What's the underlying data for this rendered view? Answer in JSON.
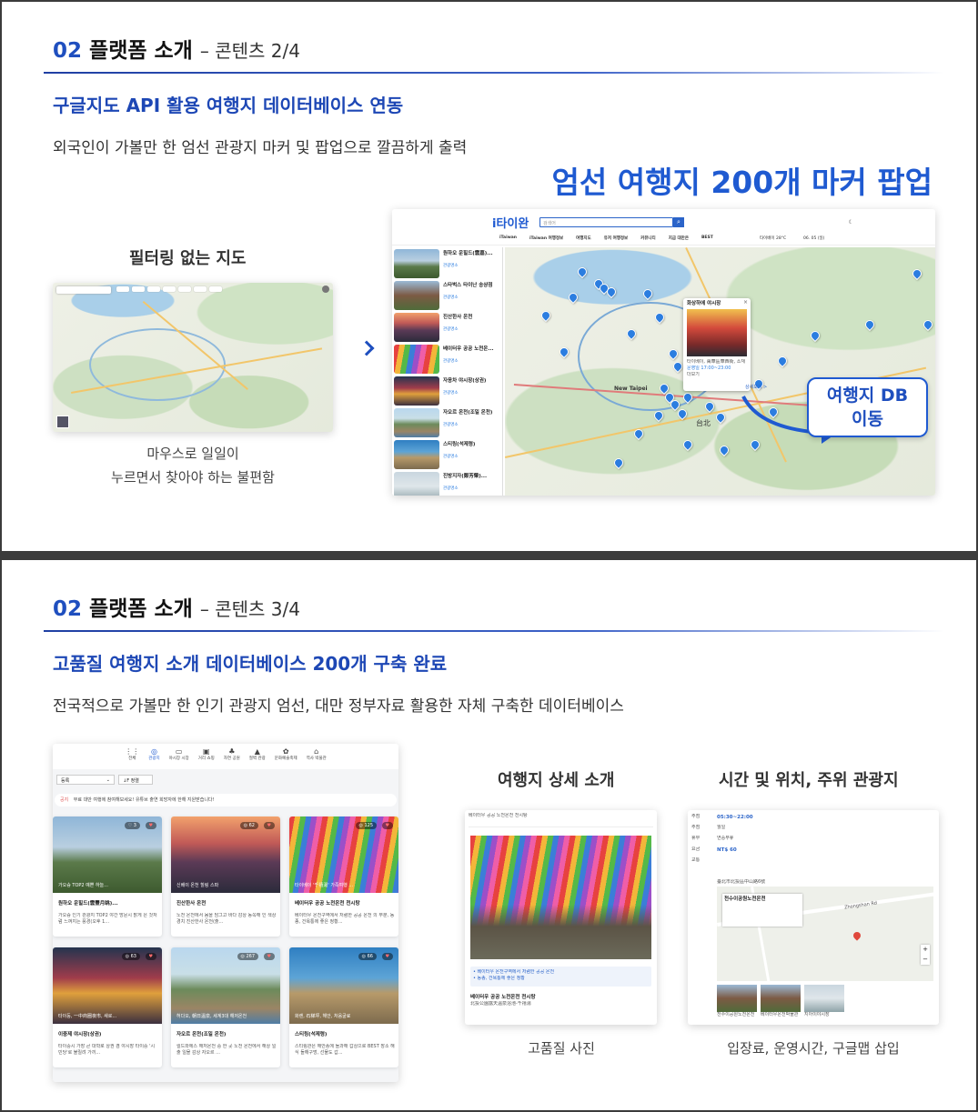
{
  "slide1": {
    "section_num": "02",
    "section_title": "플랫폼 소개",
    "section_sub": "– 콘텐츠 2/4",
    "heading": "구글지도 API 활용 여행지 데이터베이스 연동",
    "description": "외국인이 가볼만 한 엄선 관광지 마커 및 팝업으로 깔끔하게 출력",
    "highlight": "엄선 여행지 200개 마커 팝업",
    "left_caption": "필터링 없는 지도",
    "left_note_line1": "마우스로 일일이",
    "left_note_line2": "누르면서 찾아야 하는 불편함",
    "db_label_line1": "여행지 DB",
    "db_label_line2": "이동",
    "app": {
      "logo": "i타이완",
      "search_placeholder": "검색어",
      "nav": [
        "iTaiwan",
        "iTaiwan 여행정보",
        "여행지도",
        "유저 여행정보",
        "커뮤니티",
        "지금 대만은",
        "BEST"
      ],
      "weather": "타이베이 28°C",
      "date": "06. 05 (일)",
      "list": [
        {
          "title": "원하오 운힐드(雲嘉)...",
          "tag": "관광명소"
        },
        {
          "title": "스타벅스 타이난 송샹점",
          "tag": "관광명소"
        },
        {
          "title": "진산한사 온천",
          "tag": "관광명소"
        },
        {
          "title": "베이터우 공공 노천온...",
          "tag": "관광명소"
        },
        {
          "title": "자응차 야시장(상권)",
          "tag": "관광명소"
        },
        {
          "title": "자오르 온천(조일 온천)",
          "tag": "관광명소"
        },
        {
          "title": "스티링(석제령)",
          "tag": "관광명소"
        },
        {
          "title": "진방지자(鄭芳榮)...",
          "tag": "관광명소"
        }
      ],
      "popup_title": "화상하에 야시장",
      "popup_lines": [
        "타이베이, 萬華區華西街, 소재",
        "운영일 17:00~23:00",
        "더보기"
      ],
      "popup_more": "상세보기 >",
      "map_label_city": "New Taipei",
      "map_label_taipei": "台北"
    }
  },
  "slide2": {
    "section_num": "02",
    "section_title": "플랫폼 소개",
    "section_sub": "– 콘텐츠 3/4",
    "heading": "고품질 여행지 소개 데이터베이스 200개 구축 완료",
    "description": "전국적으로 가볼만 한 인기 관광지 엄선, 대만 정부자료 활용한 자체 구축한 데이터베이스",
    "categories": [
      "전체",
      "관광지",
      "야시장 시장",
      "거리 쇼핑",
      "자연 공원",
      "절벽 관광",
      "문화예술축제",
      "역사 박물관"
    ],
    "filter_sort": "등록",
    "filter_order": "↓F 정렬",
    "notice_tag": "공지",
    "notice_text": "무료 대만 여행에 참여해보세요! 유튜브 출연 희망자에 한해 지원받습니다!",
    "cards": [
      {
        "overlay": "가오슝 TOP2 예쁜 하늘...",
        "title": "원하오 운힐드(雲豐月眺)...",
        "desc": "가오슝 인기 관광지 TOP2 야간 방문시 밝게 은 것처럼 느껴지는 풍경(오후 1...",
        "views": "♡ 3",
        "grad": "g-sky"
      },
      {
        "overlay": "신베이 온천 힐링 스파",
        "title": "진산한사 온천",
        "desc": "노천 온천에서 몸을 담그고 바다 감상 동쪽해 인 색상 경치 진산한사 온천(출...",
        "views": "◎ 62",
        "grad": "g-sunset"
      },
      {
        "overlay": "타이베이 '千禧湯' 가족여행 ...",
        "title": "베이터우 공공 노천온천 천시탕",
        "desc": "베이터우 온천구역에서 저렴한 공공 온천 의 부분, 동종, 건욕통에 좋은 정황...",
        "views": "◎ 125",
        "grad": "g-rain"
      },
      {
        "overlay": "타이둥, 一中商圈夜市, 새로...",
        "title": "이중제 야시장(상권)",
        "desc": "타이중시 가장 큰 대학로 상권 겸 야시장 타이중 '시민당'로 불릴려 가끼...",
        "views": "◎ 63",
        "grad": "g-night"
      },
      {
        "overlay": "허다오, 朝日溫泉, 세계3대 해저온천",
        "title": "자오르 온천(조일 온천)",
        "desc": "릴드와에스 해저온천 중 한 곳 노천 온천에서 해상 일출 일몰 감상 자오르 ...",
        "views": "◎ 267",
        "grad": "g-coast"
      },
      {
        "overlay": "화롄, 石梯坪, 해안, 처음굴료",
        "title": "스티링(석제령)",
        "desc": "스티링관은 해안풍에 돌과해 갑상으로 BEST 장소 해식 돌해구멍, 선물도 갑...",
        "views": "◎ 66",
        "grad": "g-rock"
      }
    ],
    "caption_detail": "여행지 상세 소개",
    "caption_location": "시간 및 위치, 주위 관광지",
    "note_detail": "고품질 사진",
    "note_location": "입장료, 운영시간, 구글맵 삽입",
    "detail": {
      "breadcrumb": "베이터우 공공 노천온천 천시탕",
      "info": [
        "베이터우 공공 노천온천 천시탕",
        "北投公園露天溫泉浴池-千禧湯"
      ],
      "bullets": [
        "• 베이터우 온천구역에서 저렴한 공공 온천",
        "• 동종, 건욕통에 좋은 정황"
      ]
    },
    "location": {
      "rows": [
        {
          "label": "주점",
          "value": "05:30~22:00"
        },
        {
          "label": "주점",
          "value": "월일"
        },
        {
          "label": "휴무",
          "value": "연중무휴"
        },
        {
          "label": "요금",
          "value": "NT$ 60"
        },
        {
          "label": "교통",
          "value": ""
        }
      ],
      "address": "臺北市北投區中山路6號",
      "road": "Zhongshan Rd",
      "place": "천수이공원노천온천",
      "nearby": [
        "천수이공원노천온천",
        "베이터우온천박물관",
        "지아이야시장"
      ]
    }
  }
}
